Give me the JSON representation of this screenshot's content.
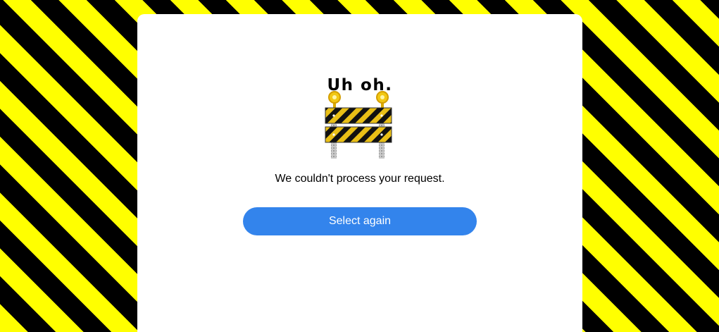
{
  "error": {
    "title": "Uh oh.",
    "message": "We couldn't process your request.",
    "illustration": "road-barrier-icon",
    "button_label": "Select again"
  },
  "colors": {
    "stripe_yellow": "#ffff00",
    "stripe_black": "#000000",
    "card_background": "#ffffff",
    "button_blue": "#3384ec",
    "button_text": "#ffffff",
    "barrier_yellow": "#e9bf16",
    "lamp_yellow": "#f2c814"
  }
}
